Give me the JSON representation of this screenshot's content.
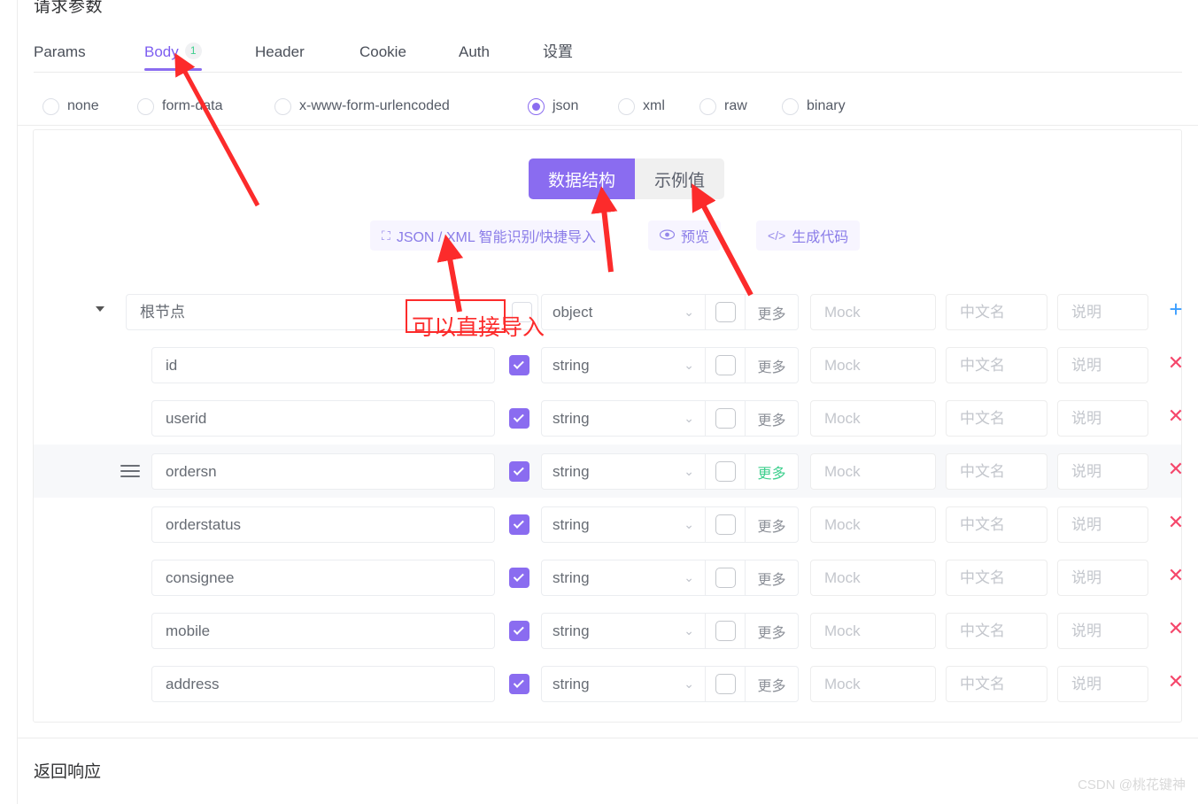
{
  "section": {
    "title": "请求参数",
    "response_title": "返回响应"
  },
  "tabs": [
    {
      "label": "Params",
      "active": false,
      "badge": ""
    },
    {
      "label": "Body",
      "active": true,
      "badge": "1"
    },
    {
      "label": "Header",
      "active": false,
      "badge": ""
    },
    {
      "label": "Cookie",
      "active": false,
      "badge": ""
    },
    {
      "label": "Auth",
      "active": false,
      "badge": ""
    },
    {
      "label": "设置",
      "active": false,
      "badge": ""
    }
  ],
  "body_type_radios": [
    {
      "label": "none",
      "checked": false
    },
    {
      "label": "form-data",
      "checked": false
    },
    {
      "label": "x-www-form-urlencoded",
      "checked": false
    },
    {
      "label": "json",
      "checked": true
    },
    {
      "label": "xml",
      "checked": false
    },
    {
      "label": "raw",
      "checked": false
    },
    {
      "label": "binary",
      "checked": false
    }
  ],
  "view_toggle": [
    {
      "label": "数据结构",
      "active": true
    },
    {
      "label": "示例值",
      "active": false
    }
  ],
  "action_links": [
    {
      "label": "JSON / XML 智能识别/快捷导入",
      "icon": "scan-import-icon",
      "glyph": "⛶"
    },
    {
      "label": "预览",
      "icon": "eye-icon",
      "glyph": "◉"
    },
    {
      "label": "生成代码",
      "icon": "code-icon",
      "glyph": "</>"
    }
  ],
  "placeholders": {
    "mock": "Mock",
    "cn_name": "中文名",
    "description": "说明"
  },
  "labels": {
    "more": "更多",
    "chevron": "⌄"
  },
  "rows": [
    {
      "name": "根节点",
      "type": "object",
      "enabled": false,
      "required": false,
      "level": 0,
      "hover": false,
      "more_highlight": false,
      "removable": false
    },
    {
      "name": "id",
      "type": "string",
      "enabled": true,
      "required": false,
      "level": 1,
      "hover": false,
      "more_highlight": false,
      "removable": true
    },
    {
      "name": "userid",
      "type": "string",
      "enabled": true,
      "required": false,
      "level": 1,
      "hover": false,
      "more_highlight": false,
      "removable": true
    },
    {
      "name": "ordersn",
      "type": "string",
      "enabled": true,
      "required": false,
      "level": 1,
      "hover": true,
      "more_highlight": true,
      "removable": true
    },
    {
      "name": "orderstatus",
      "type": "string",
      "enabled": true,
      "required": false,
      "level": 1,
      "hover": false,
      "more_highlight": false,
      "removable": true
    },
    {
      "name": "consignee",
      "type": "string",
      "enabled": true,
      "required": false,
      "level": 1,
      "hover": false,
      "more_highlight": false,
      "removable": true
    },
    {
      "name": "mobile",
      "type": "string",
      "enabled": true,
      "required": false,
      "level": 1,
      "hover": false,
      "more_highlight": false,
      "removable": true
    },
    {
      "name": "address",
      "type": "string",
      "enabled": true,
      "required": false,
      "level": 1,
      "hover": false,
      "more_highlight": false,
      "removable": true
    }
  ],
  "annotations": {
    "note_text": "可以直接导入",
    "color": "#fc2b2b"
  },
  "watermark": "CSDN @桃花键神"
}
